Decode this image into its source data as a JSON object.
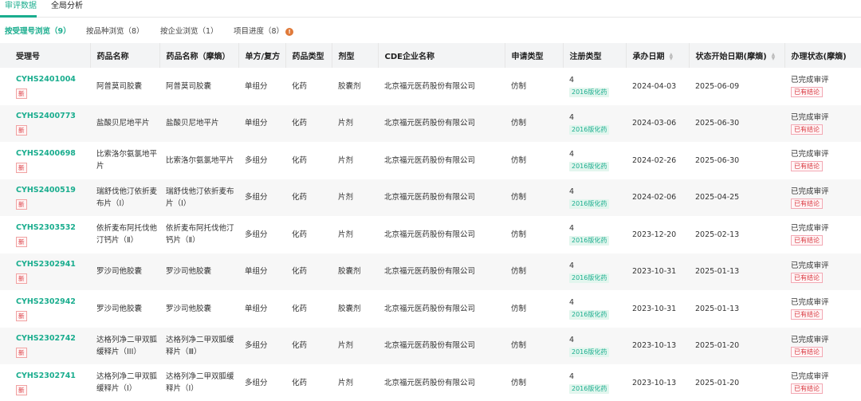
{
  "top_tabs": [
    {
      "label": "审评数据",
      "active": true
    },
    {
      "label": "全局分析",
      "active": false
    }
  ],
  "sub_tabs": [
    {
      "label": "按受理号浏览（9）",
      "active": true
    },
    {
      "label": "按品种浏览（8）",
      "active": false
    },
    {
      "label": "按企业浏览（1）",
      "active": false
    },
    {
      "label": "项目进度（8）",
      "active": false,
      "info_icon": "info-icon"
    }
  ],
  "table": {
    "headers": [
      "受理号",
      "药品名称",
      "药品名称（摩熵）",
      "单方/复方",
      "药品类型",
      "剂型",
      "CDE企业名称",
      "申请类型",
      "注册类型",
      "承办日期",
      "状态开始日期(摩熵)",
      "办理状态(摩熵)"
    ],
    "rows": [
      {
        "acceptance_no": "CYHS2401004",
        "new_badge": "新",
        "drug_name": "阿普莫司胶囊",
        "drug_name_ms": "阿普莫司胶囊",
        "composition": "单组分",
        "drug_type": "化药",
        "dosage_form": "胶囊剂",
        "company": "北京福元医药股份有限公司",
        "app_type": "仿制",
        "reg_type": "4",
        "reg_badge": "2016版化药",
        "filing_date": "2024-04-03",
        "status_start": "2025-06-09",
        "status": "已完成审评",
        "status_badge": "已有结论"
      },
      {
        "acceptance_no": "CYHS2400773",
        "new_badge": "新",
        "drug_name": "盐酸贝尼地平片",
        "drug_name_ms": "盐酸贝尼地平片",
        "composition": "单组分",
        "drug_type": "化药",
        "dosage_form": "片剂",
        "company": "北京福元医药股份有限公司",
        "app_type": "仿制",
        "reg_type": "4",
        "reg_badge": "2016版化药",
        "filing_date": "2024-03-06",
        "status_start": "2025-06-30",
        "status": "已完成审评",
        "status_badge": "已有结论"
      },
      {
        "acceptance_no": "CYHS2400698",
        "new_badge": "新",
        "drug_name": "比索洛尔氨氯地平片",
        "drug_name_ms": "比索洛尔氨氯地平片",
        "composition": "多组分",
        "drug_type": "化药",
        "dosage_form": "片剂",
        "company": "北京福元医药股份有限公司",
        "app_type": "仿制",
        "reg_type": "4",
        "reg_badge": "2016版化药",
        "filing_date": "2024-02-26",
        "status_start": "2025-06-30",
        "status": "已完成审评",
        "status_badge": "已有结论"
      },
      {
        "acceptance_no": "CYHS2400519",
        "new_badge": "新",
        "drug_name": "瑞舒伐他汀依折麦布片（I）",
        "drug_name_ms": "瑞舒伐他汀依折麦布片（I）",
        "composition": "多组分",
        "drug_type": "化药",
        "dosage_form": "片剂",
        "company": "北京福元医药股份有限公司",
        "app_type": "仿制",
        "reg_type": "4",
        "reg_badge": "2016版化药",
        "filing_date": "2024-02-06",
        "status_start": "2025-04-25",
        "status": "已完成审评",
        "status_badge": "已有结论"
      },
      {
        "acceptance_no": "CYHS2303532",
        "new_badge": "新",
        "drug_name": "依折麦布阿托伐他汀钙片（Ⅱ）",
        "drug_name_ms": "依折麦布阿托伐他汀钙片（Ⅱ）",
        "composition": "多组分",
        "drug_type": "化药",
        "dosage_form": "片剂",
        "company": "北京福元医药股份有限公司",
        "app_type": "仿制",
        "reg_type": "4",
        "reg_badge": "2016版化药",
        "filing_date": "2023-12-20",
        "status_start": "2025-02-13",
        "status": "已完成审评",
        "status_badge": "已有结论"
      },
      {
        "acceptance_no": "CYHS2302941",
        "new_badge": "新",
        "drug_name": "罗沙司他胶囊",
        "drug_name_ms": "罗沙司他胶囊",
        "composition": "单组分",
        "drug_type": "化药",
        "dosage_form": "胶囊剂",
        "company": "北京福元医药股份有限公司",
        "app_type": "仿制",
        "reg_type": "4",
        "reg_badge": "2016版化药",
        "filing_date": "2023-10-31",
        "status_start": "2025-01-13",
        "status": "已完成审评",
        "status_badge": "已有结论"
      },
      {
        "acceptance_no": "CYHS2302942",
        "new_badge": "新",
        "drug_name": "罗沙司他胶囊",
        "drug_name_ms": "罗沙司他胶囊",
        "composition": "单组分",
        "drug_type": "化药",
        "dosage_form": "胶囊剂",
        "company": "北京福元医药股份有限公司",
        "app_type": "仿制",
        "reg_type": "4",
        "reg_badge": "2016版化药",
        "filing_date": "2023-10-31",
        "status_start": "2025-01-13",
        "status": "已完成审评",
        "status_badge": "已有结论"
      },
      {
        "acceptance_no": "CYHS2302742",
        "new_badge": "新",
        "drug_name": "达格列净二甲双胍缓释片（III）",
        "drug_name_ms": "达格列净二甲双胍缓释片（Ⅲ）",
        "composition": "多组分",
        "drug_type": "化药",
        "dosage_form": "片剂",
        "company": "北京福元医药股份有限公司",
        "app_type": "仿制",
        "reg_type": "4",
        "reg_badge": "2016版化药",
        "filing_date": "2023-10-13",
        "status_start": "2025-01-20",
        "status": "已完成审评",
        "status_badge": "已有结论"
      },
      {
        "acceptance_no": "CYHS2302741",
        "new_badge": "新",
        "drug_name": "达格列净二甲双胍缓释片（I）",
        "drug_name_ms": "达格列净二甲双胍缓释片（Ⅰ）",
        "composition": "多组分",
        "drug_type": "化药",
        "dosage_form": "片剂",
        "company": "北京福元医药股份有限公司",
        "app_type": "仿制",
        "reg_type": "4",
        "reg_badge": "2016版化药",
        "filing_date": "2023-10-13",
        "status_start": "2025-01-20",
        "status": "已完成审评",
        "status_badge": "已有结论"
      }
    ]
  },
  "colors": {
    "accent": "#1aad8e",
    "danger": "#d9363e",
    "info": "#e07a3a"
  }
}
